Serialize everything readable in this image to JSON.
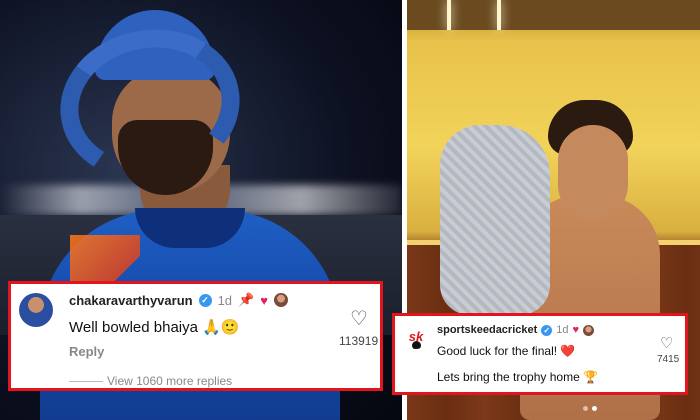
{
  "left_comment": {
    "username": "chakaravarthyvarun",
    "verified": true,
    "time": "1d",
    "pinned_icon": "pin-icon",
    "liked_by_author_icon": "heart-icon",
    "text": "Well bowled bhaiya",
    "emojis": [
      "🙏",
      "🙂"
    ],
    "reply_label": "Reply",
    "like_count": "113919",
    "view_replies": "View 1060 more replies"
  },
  "right_comment": {
    "username": "sportskeedacricket",
    "verified": true,
    "time": "1d",
    "liked_by_author_icon": "heart-icon",
    "line1": "Good luck for the final!",
    "line1_emoji": "❤️",
    "line2": "Lets bring the trophy home",
    "line2_emoji": "🏆",
    "like_count": "7415",
    "avatar_logo": "sk"
  },
  "colors": {
    "highlight_border": "#e2151f",
    "verified_badge": "#3897f0",
    "heart": "#e0245e"
  }
}
